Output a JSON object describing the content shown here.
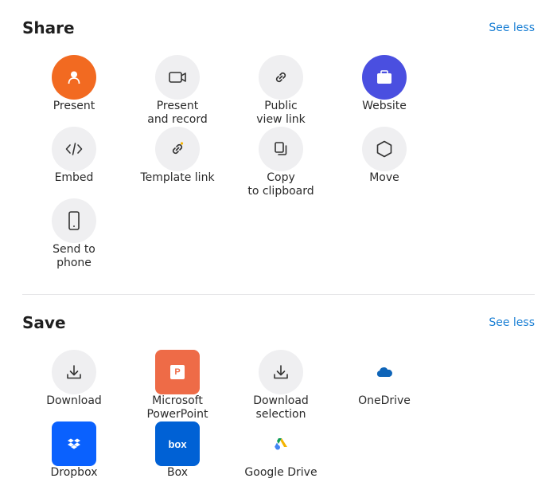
{
  "share": {
    "title": "Share",
    "see_less": "See less",
    "items": [
      {
        "label": "Present",
        "icon": "present-icon",
        "color": "#f26a21"
      },
      {
        "label": "Present\nand record",
        "icon": "video-camera-icon"
      },
      {
        "label": "Public\nview link",
        "icon": "link-icon"
      },
      {
        "label": "Website",
        "icon": "briefcase-icon",
        "color": "#4a4fe0"
      },
      {
        "label": "Embed",
        "icon": "code-icon"
      },
      {
        "label": "Template link",
        "icon": "template-link-icon"
      },
      {
        "label": "Copy\nto clipboard",
        "icon": "copy-icon"
      },
      {
        "label": "Move",
        "icon": "hexagon-icon"
      },
      {
        "label": "Send to\nphone",
        "icon": "phone-icon"
      }
    ]
  },
  "save": {
    "title": "Save",
    "see_less": "See less",
    "items": [
      {
        "label": "Download",
        "icon": "download-icon"
      },
      {
        "label": "Microsoft\nPowerPoint",
        "icon": "powerpoint-icon",
        "color": "#ee6b47",
        "badge": "P"
      },
      {
        "label": "Download\nselection",
        "icon": "download-selection-icon"
      },
      {
        "label": "OneDrive",
        "icon": "onedrive-icon",
        "color": "#0e64b8"
      },
      {
        "label": "Dropbox",
        "icon": "dropbox-icon",
        "color": "#0a61fe"
      },
      {
        "label": "Box",
        "icon": "box-icon",
        "color": "#0061d5",
        "badge": "box"
      },
      {
        "label": "Google Drive",
        "icon": "google-drive-icon"
      }
    ]
  }
}
